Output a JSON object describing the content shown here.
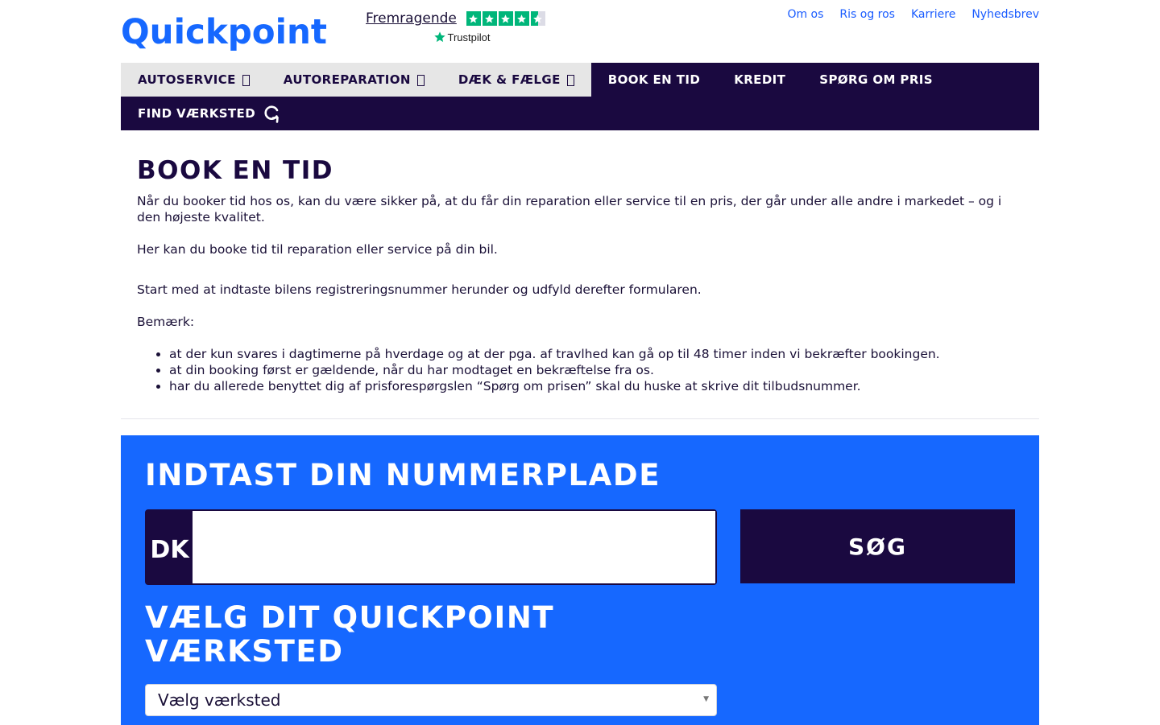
{
  "header": {
    "logo_text": "Quickpoint",
    "trustpilot": {
      "rating_label": "Fremragende",
      "stars": 4.5,
      "brand": "Trustpilot"
    },
    "top_links": [
      "Om os",
      "Ris og ros",
      "Karriere",
      "Nyhedsbrev"
    ]
  },
  "nav": {
    "items": [
      {
        "label": "AUTOSERVICE",
        "dropdown": true
      },
      {
        "label": "AUTOREPARATION",
        "dropdown": true
      },
      {
        "label": "DÆK & FÆLGE",
        "dropdown": true
      },
      {
        "label": "BOOK EN TID",
        "dropdown": false
      },
      {
        "label": "KREDIT",
        "dropdown": false
      },
      {
        "label": "SPØRG OM PRIS",
        "dropdown": false
      },
      {
        "label": "FIND VÆRKSTED",
        "icon": "refresh-icon"
      }
    ]
  },
  "content": {
    "title": "BOOK EN TID",
    "intro": "Når du booker tid hos os, kan du være sikker på, at du får din reparation eller service til en pris, der går under alle andre i markedet – og i den højeste kvalitet.",
    "p2": "Her kan du booke tid til reparation eller service på din bil.",
    "p3": "Start med at indtaste bilens registreringsnummer herunder og udfyld derefter formularen.",
    "note_label": "Bemærk:",
    "bullets": [
      "at der kun svares i dagtimerne på hverdage og at der pga. af travlhed kan gå op til 48 timer inden vi bekræfter bookingen.",
      "at din booking først er gældende, når du har modtaget en bekræftelse fra os.",
      "har du allerede benyttet dig af prisforespørgslen “Spørg om prisen” skal du huske at skrive dit tilbudsnummer."
    ]
  },
  "booking": {
    "plate_title": "INDTAST DIN NUMMERPLADE",
    "plate_country": "DK",
    "plate_value": "",
    "search_label": "SØG",
    "workshop_title": "VÆLG DIT QUICKPOINT VÆRKSTED",
    "workshop_select_value": "Vælg værksted"
  },
  "colors": {
    "brand_blue": "#1668ff",
    "navy": "#1a0940",
    "nav_light": "#e6e6e6",
    "link_blue": "#1a5cff",
    "trustpilot_green": "#00b67a"
  }
}
